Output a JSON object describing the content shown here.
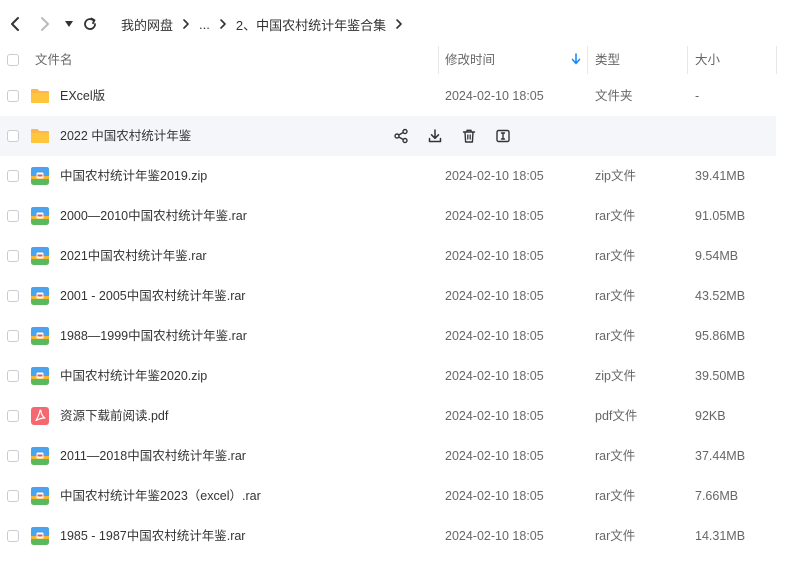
{
  "nav": {
    "crumbs": [
      "我的网盘",
      "...",
      "2、中国农村统计年鉴合集"
    ]
  },
  "header": {
    "name": "文件名",
    "modified": "修改时间",
    "type": "类型",
    "size": "大小"
  },
  "rows": [
    {
      "name": "EXcel版",
      "date": "2024-02-10 18:05",
      "type": "文件夹",
      "size": "-",
      "icon": "folder-icon"
    },
    {
      "name": "2022 中国农村统计年鉴",
      "date": "",
      "type": "",
      "size": "",
      "icon": "folder-icon"
    },
    {
      "name": "中国农村统计年鉴2019.zip",
      "date": "2024-02-10 18:05",
      "type": "zip文件",
      "size": "39.41MB",
      "icon": "archive-icon"
    },
    {
      "name": "2000—2010中国农村统计年鉴.rar",
      "date": "2024-02-10 18:05",
      "type": "rar文件",
      "size": "91.05MB",
      "icon": "archive-icon"
    },
    {
      "name": "2021中国农村统计年鉴.rar",
      "date": "2024-02-10 18:05",
      "type": "rar文件",
      "size": "9.54MB",
      "icon": "archive-icon"
    },
    {
      "name": "2001 - 2005中国农村统计年鉴.rar",
      "date": "2024-02-10 18:05",
      "type": "rar文件",
      "size": "43.52MB",
      "icon": "archive-icon"
    },
    {
      "name": "1988—1999中国农村统计年鉴.rar",
      "date": "2024-02-10 18:05",
      "type": "rar文件",
      "size": "95.86MB",
      "icon": "archive-icon"
    },
    {
      "name": "中国农村统计年鉴2020.zip",
      "date": "2024-02-10 18:05",
      "type": "zip文件",
      "size": "39.50MB",
      "icon": "archive-icon"
    },
    {
      "name": "资源下载前阅读.pdf",
      "date": "2024-02-10 18:05",
      "type": "pdf文件",
      "size": "92KB",
      "icon": "pdf-icon"
    },
    {
      "name": "2011—2018中国农村统计年鉴.rar",
      "date": "2024-02-10 18:05",
      "type": "rar文件",
      "size": "37.44MB",
      "icon": "archive-icon"
    },
    {
      "name": "中国农村统计年鉴2023（excel）.rar",
      "date": "2024-02-10 18:05",
      "type": "rar文件",
      "size": "7.66MB",
      "icon": "archive-icon"
    },
    {
      "name": "1985 - 1987中国农村统计年鉴.rar",
      "date": "2024-02-10 18:05",
      "type": "rar文件",
      "size": "14.31MB",
      "icon": "archive-icon"
    }
  ],
  "colors": {
    "sort_arrow": "#1a8cff",
    "folder": "#ffc53d",
    "pdf": "#f5686f"
  }
}
